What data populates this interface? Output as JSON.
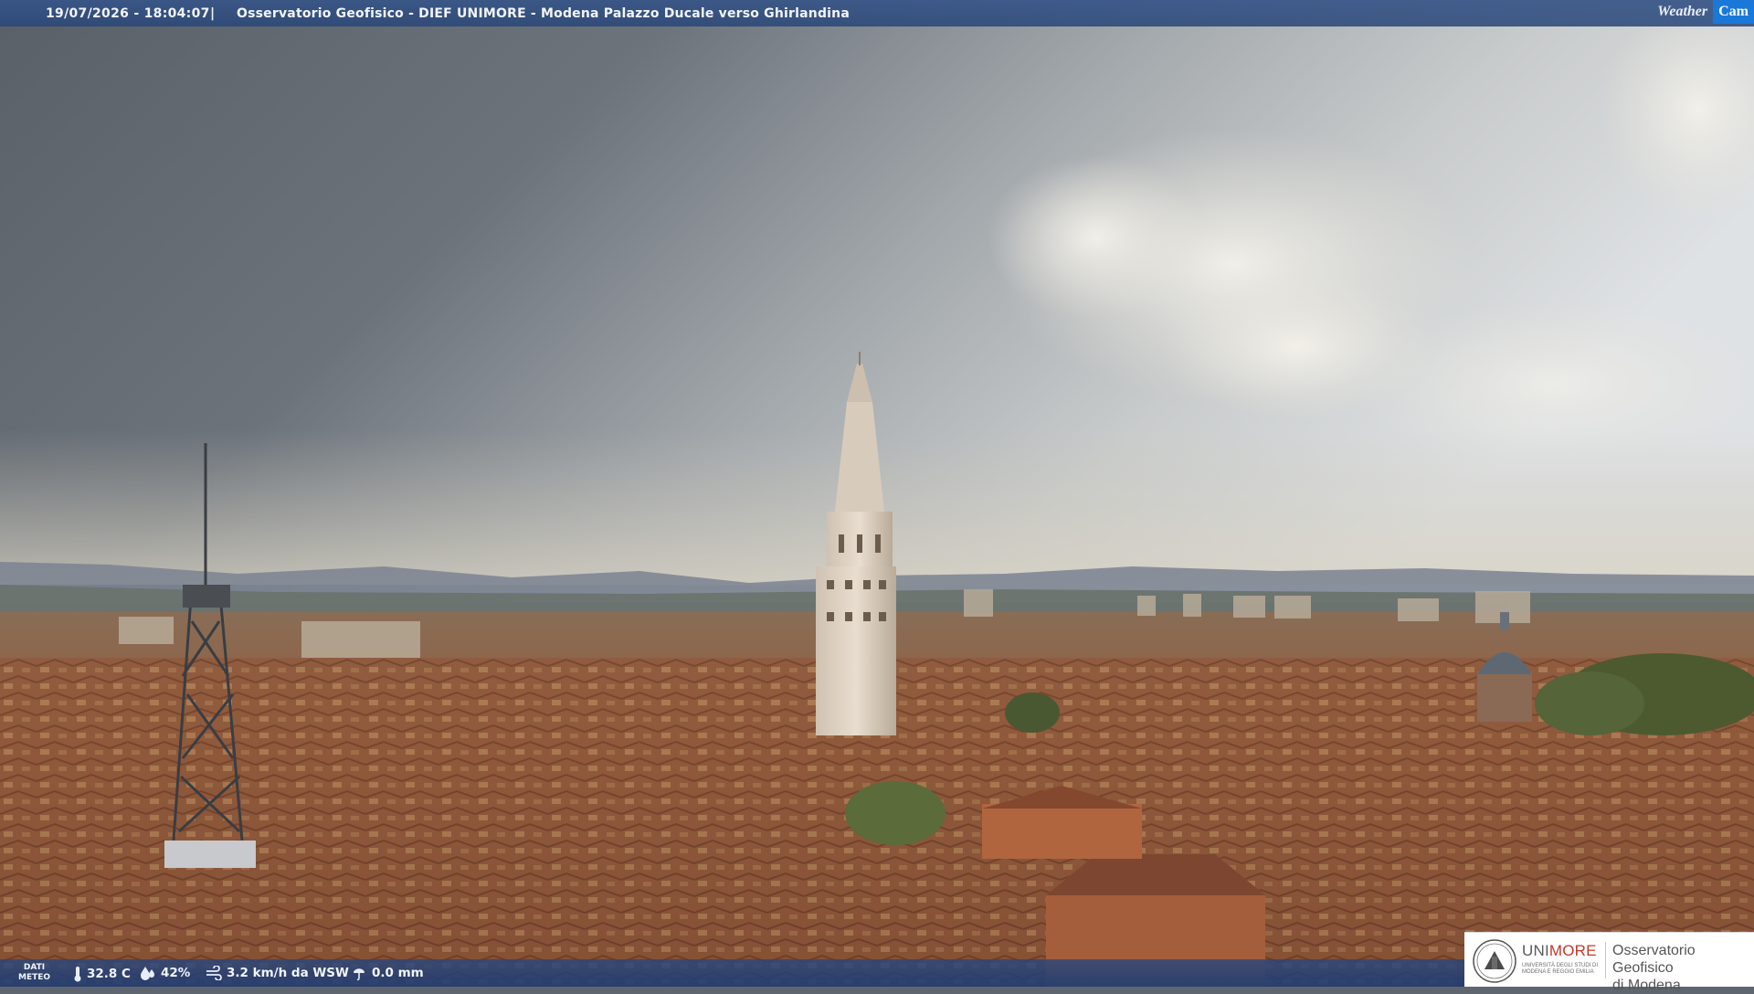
{
  "header": {
    "timestamp": "19/07/2026 - 18:04:07",
    "separator": "|",
    "title": "Osservatorio Geofisico - DIEF UNIMORE - Modena Palazzo Ducale verso Ghirlandina",
    "brand_weather": "Weather",
    "brand_cam": "Cam"
  },
  "weather": {
    "label_line1": "DATI",
    "label_line2": "METEO",
    "temperature": "32.8 C",
    "humidity": "42%",
    "wind": "3.2 km/h da WSW",
    "rain": "0.0 mm",
    "icons": [
      "thermometer-icon",
      "humidity-drop-icon",
      "wind-icon",
      "rain-gauge-icon"
    ]
  },
  "logo": {
    "name_part1": "UNI",
    "name_part2": "MORE",
    "subtitle": "UNIVERSITÀ DEGLI STUDI DI MODENA E REGGIO EMILIA",
    "observatory_line1": "Osservatorio Geofisico",
    "observatory_line2": "di Modena"
  },
  "colors": {
    "bar_blue": "#2e5a9e",
    "cam_blue": "#1a78d8",
    "unimore_red": "#c0392b",
    "roof_terracotta": "#9c5a3a",
    "sky_grey": "#6f767e"
  }
}
